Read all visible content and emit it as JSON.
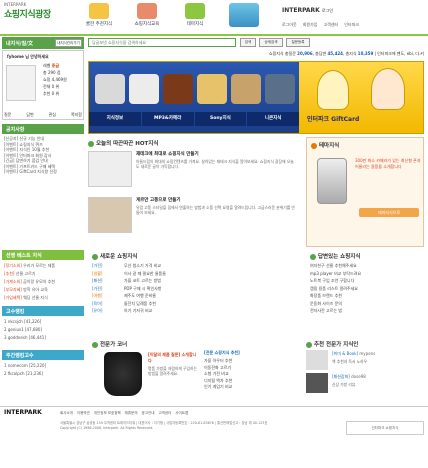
{
  "header": {
    "logo_sub": "INTERPARK",
    "logo_main": "쇼핑지식광장",
    "nav": [
      {
        "label": "쿨한 추천지식"
      },
      {
        "label": "쇼핑지식교육"
      },
      {
        "label": "테마지식"
      }
    ],
    "brand": "INTERPARK",
    "brand_sub": "로그인",
    "top_links": [
      "로그아웃",
      "회원가입",
      "고객센터",
      "인터파크"
    ]
  },
  "login": {
    "title": "내지식/질/文",
    "button": "내지식관리가기",
    "user": "fyhome 님 안녕하세요",
    "level_label": "레벨",
    "level": "중급",
    "points": "총 290 점",
    "cash": "쇼핑 4,469원",
    "rank": "전체 0 위",
    "quest": "추천 0 위",
    "tabs": [
      "질문",
      "답변",
      "관심",
      "쪽지함"
    ]
  },
  "sidebar": {
    "notice_title": "공지사항",
    "notice": [
      "[신공지] 신규 기능 안내",
      "[이벤트] 쇼핑지식 퀴즈",
      "[이벤트] 지식인 10월 추천",
      "[이벤트] 인터파크 회원 감사",
      "[긴급] 답변하기 점검 안내",
      "[이벤트] 기프트카드 구매 혜택",
      "[이벤트] GiftCard 지식왕 선정"
    ],
    "best_title": "선행 베스트 지식",
    "best": [
      {
        "tag": "[정기소외]",
        "text": "우리가 모르는 제품"
      },
      {
        "tag": "[추천]",
        "text": "선물 고르기"
      },
      {
        "tag": "[가계소외]",
        "text": "곰이랑 유모차 추천"
      },
      {
        "tag": "[부모지혜]",
        "text": "방학 유아 교육"
      },
      {
        "tag": "[가입혜택]",
        "text": "웨딩 선물 지식"
      }
    ],
    "rank_title": "고수랭킹",
    "rank": [
      {
        "n": "1",
        "id": "nkcsjch",
        "pt": "[41,226]"
      },
      {
        "n": "2",
        "id": "genius1",
        "pt": "[47,680]"
      },
      {
        "n": "3",
        "id": "goddnesh",
        "pt": "[46,441]"
      }
    ],
    "week_title": "주간랭킹고수",
    "week": [
      {
        "n": "1",
        "id": "nomecom",
        "pt": "[25,220]"
      },
      {
        "n": "2",
        "id": "fkcolpch",
        "pt": "[21,236]"
      }
    ]
  },
  "search": {
    "placeholder": "답글보낸 쇼핑지식을 검색하세요",
    "btn_search": "검색",
    "btn_advanced": "상세검색",
    "btn_ask": "질문등록"
  },
  "stats": {
    "prefix": "쇼핑지식",
    "total_label": "총질문",
    "total": "20,906",
    "answer_label": "총답변",
    "answer": "45,424",
    "know_label": "총지식",
    "know": "10,359",
    "right": "인터파크에 펜도, ebi, 다.커"
  },
  "banner": {
    "nav": [
      "지식정보",
      "MP3&카메라",
      "Sony지식",
      "니콘지식"
    ],
    "right": "인터파크 GiftCard"
  },
  "hot": {
    "title": "오늘의 따끈따끈 HOT지식",
    "articles": [
      {
        "title": "재테크에 최대로 쇼핑지식 만들기",
        "body": "아들드립이 최대의 쇼핑컨텐츠를 가져요. 살아있는 재테크 지식을 알아보세요. 쇼핑지식 광장에 오늘도 새로운 글이 가득합니다."
      },
      {
        "title": "게르만 고풍으로 만들기",
        "body": "유럽 고풍 스타일을 집에서 연출하는 방법과 소품 선택 요령을 알려드립니다. 고급스러운 분위기를 만들어 보세요."
      }
    ]
  },
  "theme": {
    "title": "테마지식",
    "text": "300만 화소 카메라가 있는 최신형 폰과 어울리는 용품을 소개합니다",
    "button": "테마지식으로"
  },
  "newq": {
    "title": "새로운 쇼핑지식",
    "rows": [
      {
        "tag": "[가전]",
        "text": "무선 청소기 가격 비교"
      },
      {
        "tag": "[생활]",
        "text": "이사 갈 때 필요한 물품들"
      },
      {
        "tag": "[패션]",
        "text": "가을 코트 고르는 방법"
      },
      {
        "tag": "[가전]",
        "text": "PDP 구매 시 확인사항"
      },
      {
        "tag": "[여행]",
        "text": "제주도 여행 준비물"
      },
      {
        "tag": "[육아]",
        "text": "돌잔치 답례품 추천"
      },
      {
        "tag": "[유아]",
        "text": "아기 기저귀 비교"
      }
    ]
  },
  "answered": {
    "title": "답변있는 쇼핑지식",
    "rows": [
      {
        "text": "여자친구 선물 추천해주세요"
      },
      {
        "text": "mp3 player 비교 부탁드려요"
      },
      {
        "text": "노트북 구입 조언 구합니다"
      },
      {
        "text": "캠핑 용품 리스트 알려주세요"
      },
      {
        "text": "화장품 브랜드 추천"
      },
      {
        "text": "운동화 사이즈 문의"
      },
      {
        "text": "전자사전 고르는 법"
      }
    ]
  },
  "best": {
    "title": "전문가 코너",
    "item_title": "[이달의 제품 질문] 소개합니다",
    "item_body": "명품 가방을 저렴하게 구입하는 방법을 알려주세요.",
    "list_title": "[전문 쇼핑지식 추천]",
    "list": [
      "가을 아우터 추천",
      "이동전화 고르기",
      "소형 가전 비교",
      "디지털 액자 추천",
      "인기 게임기 비교"
    ]
  },
  "right2": {
    "title": "추천 전문가 지식인",
    "p1_title": "[취미 & Book]",
    "p1_id": "mypens",
    "p1_text": "책 추천과 독서 노하우",
    "p2_title": "[패션잡화]",
    "p2_id": "dose98",
    "p2_text": "신상 가방 리뷰"
  },
  "footer": {
    "logo": "INTERPARK",
    "links": [
      "회사소개",
      "이용약관",
      "개인정보 보호정책",
      "제휴문의",
      "광고안내",
      "고객센터",
      "사이트맵"
    ],
    "addr": "서울특별시 강남구 삼성동 159 무역센터 트레이드타워 | 대표이사 : 이기형 | 사업자등록번호 : 220-81-83676 | 통신판매업신고 : 강남 제 00-123호",
    "copy": "Copyright (C) 1996-2008, Interpark. All Rights Reserved.",
    "badge": "인터파크 쇼핑지식"
  }
}
